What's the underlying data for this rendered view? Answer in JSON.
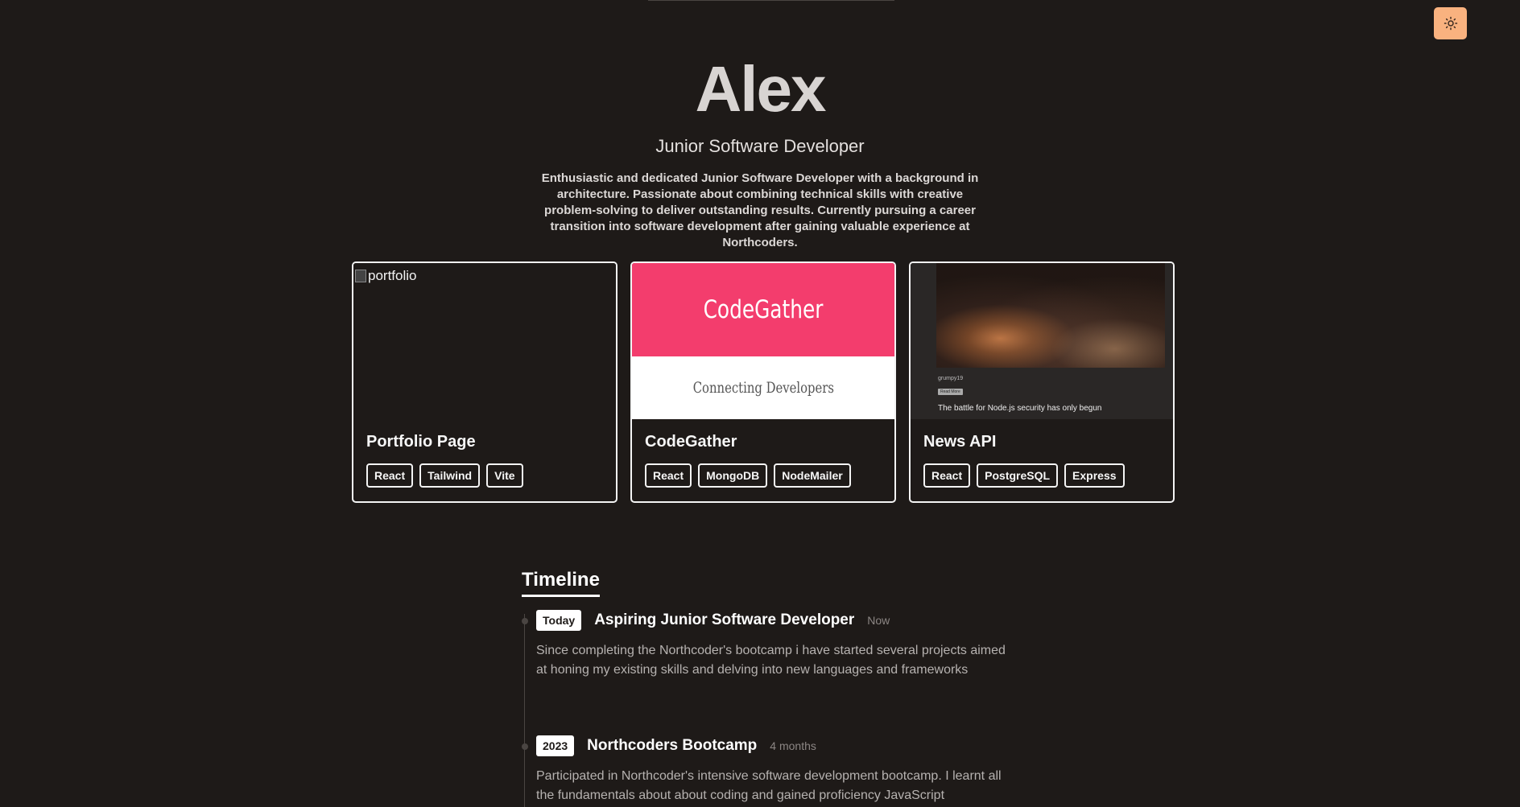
{
  "hero": {
    "name": "Alex",
    "role": "Junior Software Developer",
    "bio": "Enthusiastic and dedicated Junior Software Developer with a background in architecture. Passionate about combining technical skills with creative problem-solving to deliver outstanding results. Currently pursuing a career transition into software development after gaining valuable experience at Northcoders."
  },
  "theme_toggle": {
    "icon": "sun-icon",
    "color": "#f9b27f"
  },
  "projects": [
    {
      "title": "Portfolio Page",
      "image_alt": "portfolio",
      "tags": [
        "React",
        "Tailwind",
        "Vite"
      ]
    },
    {
      "title": "CodeGather",
      "thumb_title": "CodeGather",
      "thumb_subtitle": "Connecting Developers",
      "thumb_color": "#f33d6d",
      "tags": [
        "React",
        "MongoDB",
        "NodeMailer"
      ]
    },
    {
      "title": "News API",
      "thumb_author": "grumpy19",
      "thumb_tag": "Read More",
      "thumb_headline": "The battle for Node.js security has only begun",
      "tags": [
        "React",
        "PostgreSQL",
        "Express"
      ]
    }
  ],
  "timeline": {
    "heading": "Timeline",
    "entries": [
      {
        "badge": "Today",
        "title": "Aspiring Junior Software Developer",
        "duration": "Now",
        "description": "Since completing the Northcoder's bootcamp i have started several projects aimed at honing my existing skills and delving into new languages and frameworks"
      },
      {
        "badge": "2023",
        "title": "Northcoders Bootcamp",
        "duration": "4 months",
        "description": "Participated in Northcoder's intensive software development bootcamp. I learnt all the fundamentals about about coding and gained proficiency JavaScript"
      }
    ]
  }
}
